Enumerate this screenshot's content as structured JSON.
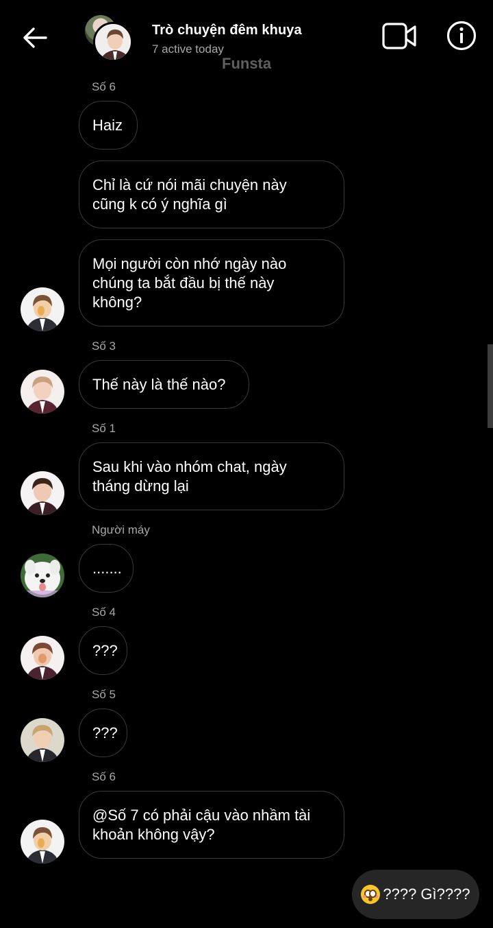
{
  "header": {
    "title": "Trò chuyện đêm khuya",
    "subtitle": "7 active today",
    "watermark": "Funsta"
  },
  "messages": [
    {
      "sender": "Số 6",
      "text": "Haiz"
    },
    {
      "text_lines": [
        "Chỉ là cứ nói mãi chuyện này",
        "cũng k có ý nghĩa gì"
      ]
    },
    {
      "text_lines": [
        "Mọi người còn nhớ ngày nào",
        "chúng ta bắt đầu bị thế này",
        "không?"
      ]
    },
    {
      "sender": "Số 3",
      "text": "Thế này là thế nào?"
    },
    {
      "sender": "Số 1",
      "text_lines": [
        "Sau khi vào nhóm chat, ngày",
        "tháng dừng lại"
      ]
    },
    {
      "sender": "Người máy",
      "text": "......."
    },
    {
      "sender": "Số 4",
      "text": "???"
    },
    {
      "sender": "Số 5",
      "text": "???"
    },
    {
      "sender": "Số 6",
      "text_lines": [
        "@Số 7 có phải cậu vào nhầm tài",
        "khoản không vậy?"
      ]
    }
  ],
  "my_message": {
    "emoji": "flushed-face",
    "text": "???? Gì????"
  },
  "colors": {
    "background": "#000000",
    "bubble_border": "#3a3a3a",
    "my_bubble": "#262626",
    "secondary_text": "#a8a8a8"
  }
}
